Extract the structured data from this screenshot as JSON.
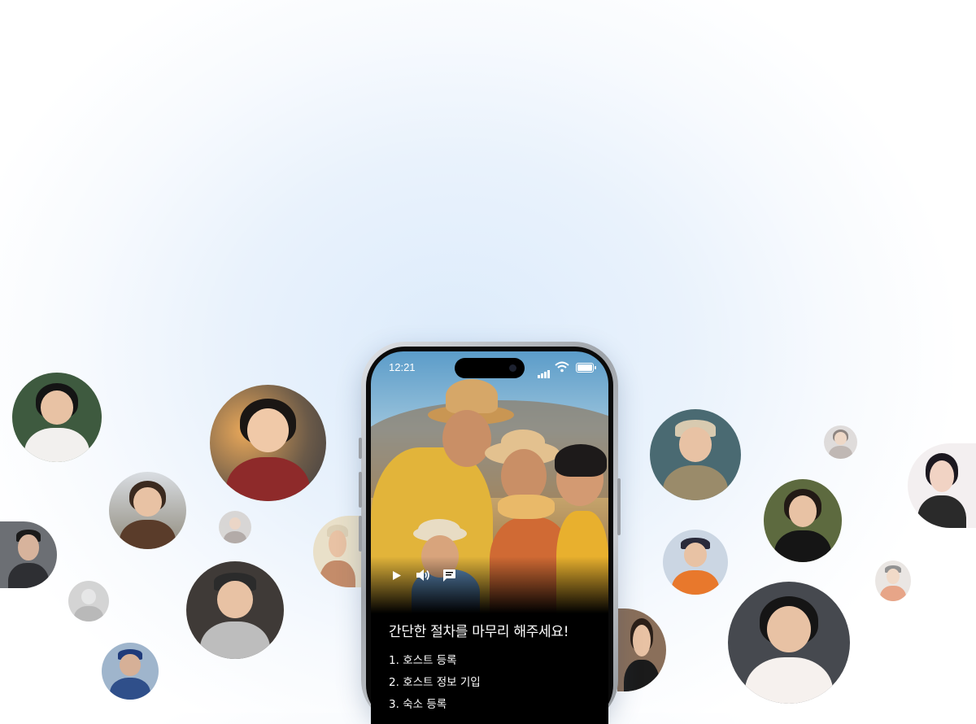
{
  "status_bar": {
    "time": "12:21"
  },
  "video": {
    "controls": [
      {
        "name": "play-icon"
      },
      {
        "name": "volume-icon"
      },
      {
        "name": "comment-icon"
      }
    ]
  },
  "caption": {
    "title": "간단한 절차를 마무리 해주세요!",
    "steps": [
      {
        "num": "1.",
        "label": "호스트 등록"
      },
      {
        "num": "2.",
        "label": "호스트 정보 기입"
      },
      {
        "num": "3.",
        "label": "숙소 등록"
      }
    ]
  },
  "avatars": [
    {
      "name": "avatar-1"
    },
    {
      "name": "avatar-2"
    },
    {
      "name": "avatar-3"
    },
    {
      "name": "avatar-4"
    },
    {
      "name": "avatar-5"
    },
    {
      "name": "avatar-6"
    },
    {
      "name": "avatar-7"
    },
    {
      "name": "avatar-8"
    },
    {
      "name": "avatar-9"
    },
    {
      "name": "avatar-10"
    },
    {
      "name": "avatar-11"
    },
    {
      "name": "avatar-12"
    },
    {
      "name": "avatar-13"
    },
    {
      "name": "avatar-14"
    },
    {
      "name": "avatar-15"
    },
    {
      "name": "avatar-16"
    },
    {
      "name": "avatar-17"
    },
    {
      "name": "avatar-18"
    }
  ],
  "colors": {
    "background": "#e6f0fb",
    "phone_frame": "#b8bcc1",
    "screen": "#000000",
    "text": "#ffffff"
  }
}
